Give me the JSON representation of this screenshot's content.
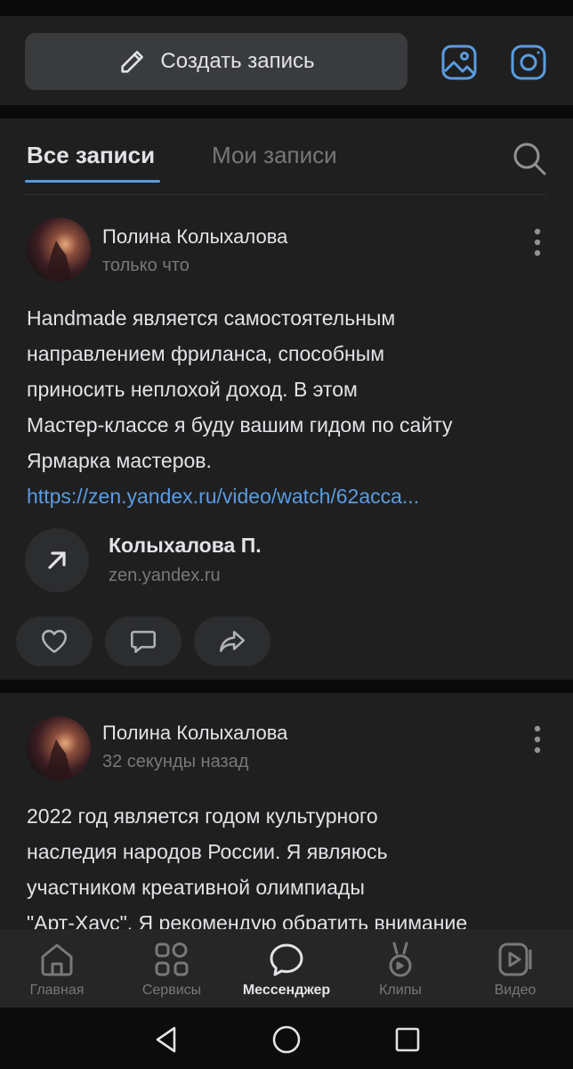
{
  "compose": {
    "label": "Создать запись",
    "icons": {
      "pencil": "pencil-icon",
      "photo": "image-icon",
      "camera": "instagram-camera-icon"
    }
  },
  "tabs": [
    {
      "label": "Все записи",
      "active": true
    },
    {
      "label": "Мои записи",
      "active": false
    }
  ],
  "posts": [
    {
      "author": "Полина Колыхалова",
      "time": "только что",
      "text_lines": [
        "Handmade является самостоятельным",
        "направлением фриланса, способным",
        "приносить неплохой доход. В этом",
        "Мастер-классе я буду вашим гидом по сайту",
        "Ярмарка мастеров."
      ],
      "link": "https://zen.yandex.ru/video/watch/62acca...",
      "attachment": {
        "title": "Колыхалова П.",
        "domain": "zen.yandex.ru"
      }
    },
    {
      "author": "Полина Колыхалова",
      "time": "32 секунды назад",
      "text_lines": [
        "2022 год является годом культурного",
        "наследия народов России. Я являюсь",
        "участником креативной олимпиады",
        "\"Арт-Хаус\". Я рекомендую обратить внимание"
      ]
    }
  ],
  "nav": [
    {
      "label": "Главная",
      "icon": "home-icon",
      "active": false
    },
    {
      "label": "Сервисы",
      "icon": "services-icon",
      "active": false
    },
    {
      "label": "Мессенджер",
      "icon": "messenger-icon",
      "active": true
    },
    {
      "label": "Клипы",
      "icon": "clips-icon",
      "active": false
    },
    {
      "label": "Видео",
      "icon": "video-icon",
      "active": false
    }
  ],
  "colors": {
    "accent": "#5a9ce0",
    "card": "#1f1f20",
    "background": "#0a0a0a",
    "muted": "#76787a"
  }
}
